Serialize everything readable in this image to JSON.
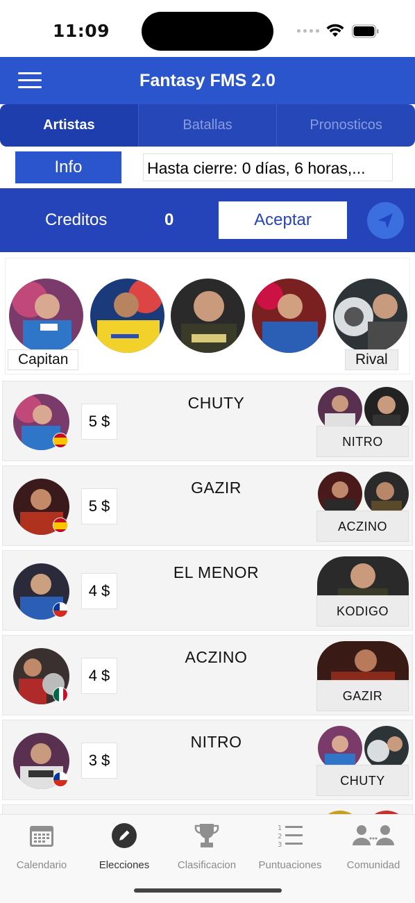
{
  "status_bar": {
    "time": "11:09"
  },
  "header": {
    "title": "Fantasy FMS 2.0",
    "menu_icon": "hamburger-menu-icon"
  },
  "tabs": [
    {
      "label": "Artistas",
      "active": true
    },
    {
      "label": "Batallas",
      "active": false
    },
    {
      "label": "Pronosticos",
      "active": false
    }
  ],
  "info": {
    "button_label": "Info",
    "deadline_text": "Hasta cierre: 0 días, 6 horas,..."
  },
  "credits": {
    "label": "Creditos",
    "value": "0",
    "accept_label": "Aceptar",
    "send_icon": "send-icon"
  },
  "team": {
    "captain_label": "Capitan",
    "rival_label": "Rival"
  },
  "artists": [
    {
      "name": "CHUTY",
      "price": "5 $",
      "rival": "NITRO",
      "flag": "spain"
    },
    {
      "name": "GAZIR",
      "price": "5 $",
      "rival": "ACZINO",
      "flag": "spain"
    },
    {
      "name": "EL MENOR",
      "price": "4 $",
      "rival": "KODIGO",
      "flag": "chile"
    },
    {
      "name": "ACZINO",
      "price": "4 $",
      "rival": "GAZIR",
      "flag": "mexico"
    },
    {
      "name": "NITRO",
      "price": "3 $",
      "rival": "CHUTY",
      "flag": "chile"
    }
  ],
  "bottom_nav": [
    {
      "label": "Calendario",
      "icon": "calendar-icon",
      "active": false
    },
    {
      "label": "Elecciones",
      "icon": "pencil-icon",
      "active": true
    },
    {
      "label": "Clasificacion",
      "icon": "trophy-icon",
      "active": false
    },
    {
      "label": "Puntuaciones",
      "icon": "numbered-list-icon",
      "active": false
    },
    {
      "label": "Comunidad",
      "icon": "community-icon",
      "active": false
    }
  ],
  "colors": {
    "brand_blue": "#2a55cc",
    "dark_blue": "#2544b9"
  }
}
